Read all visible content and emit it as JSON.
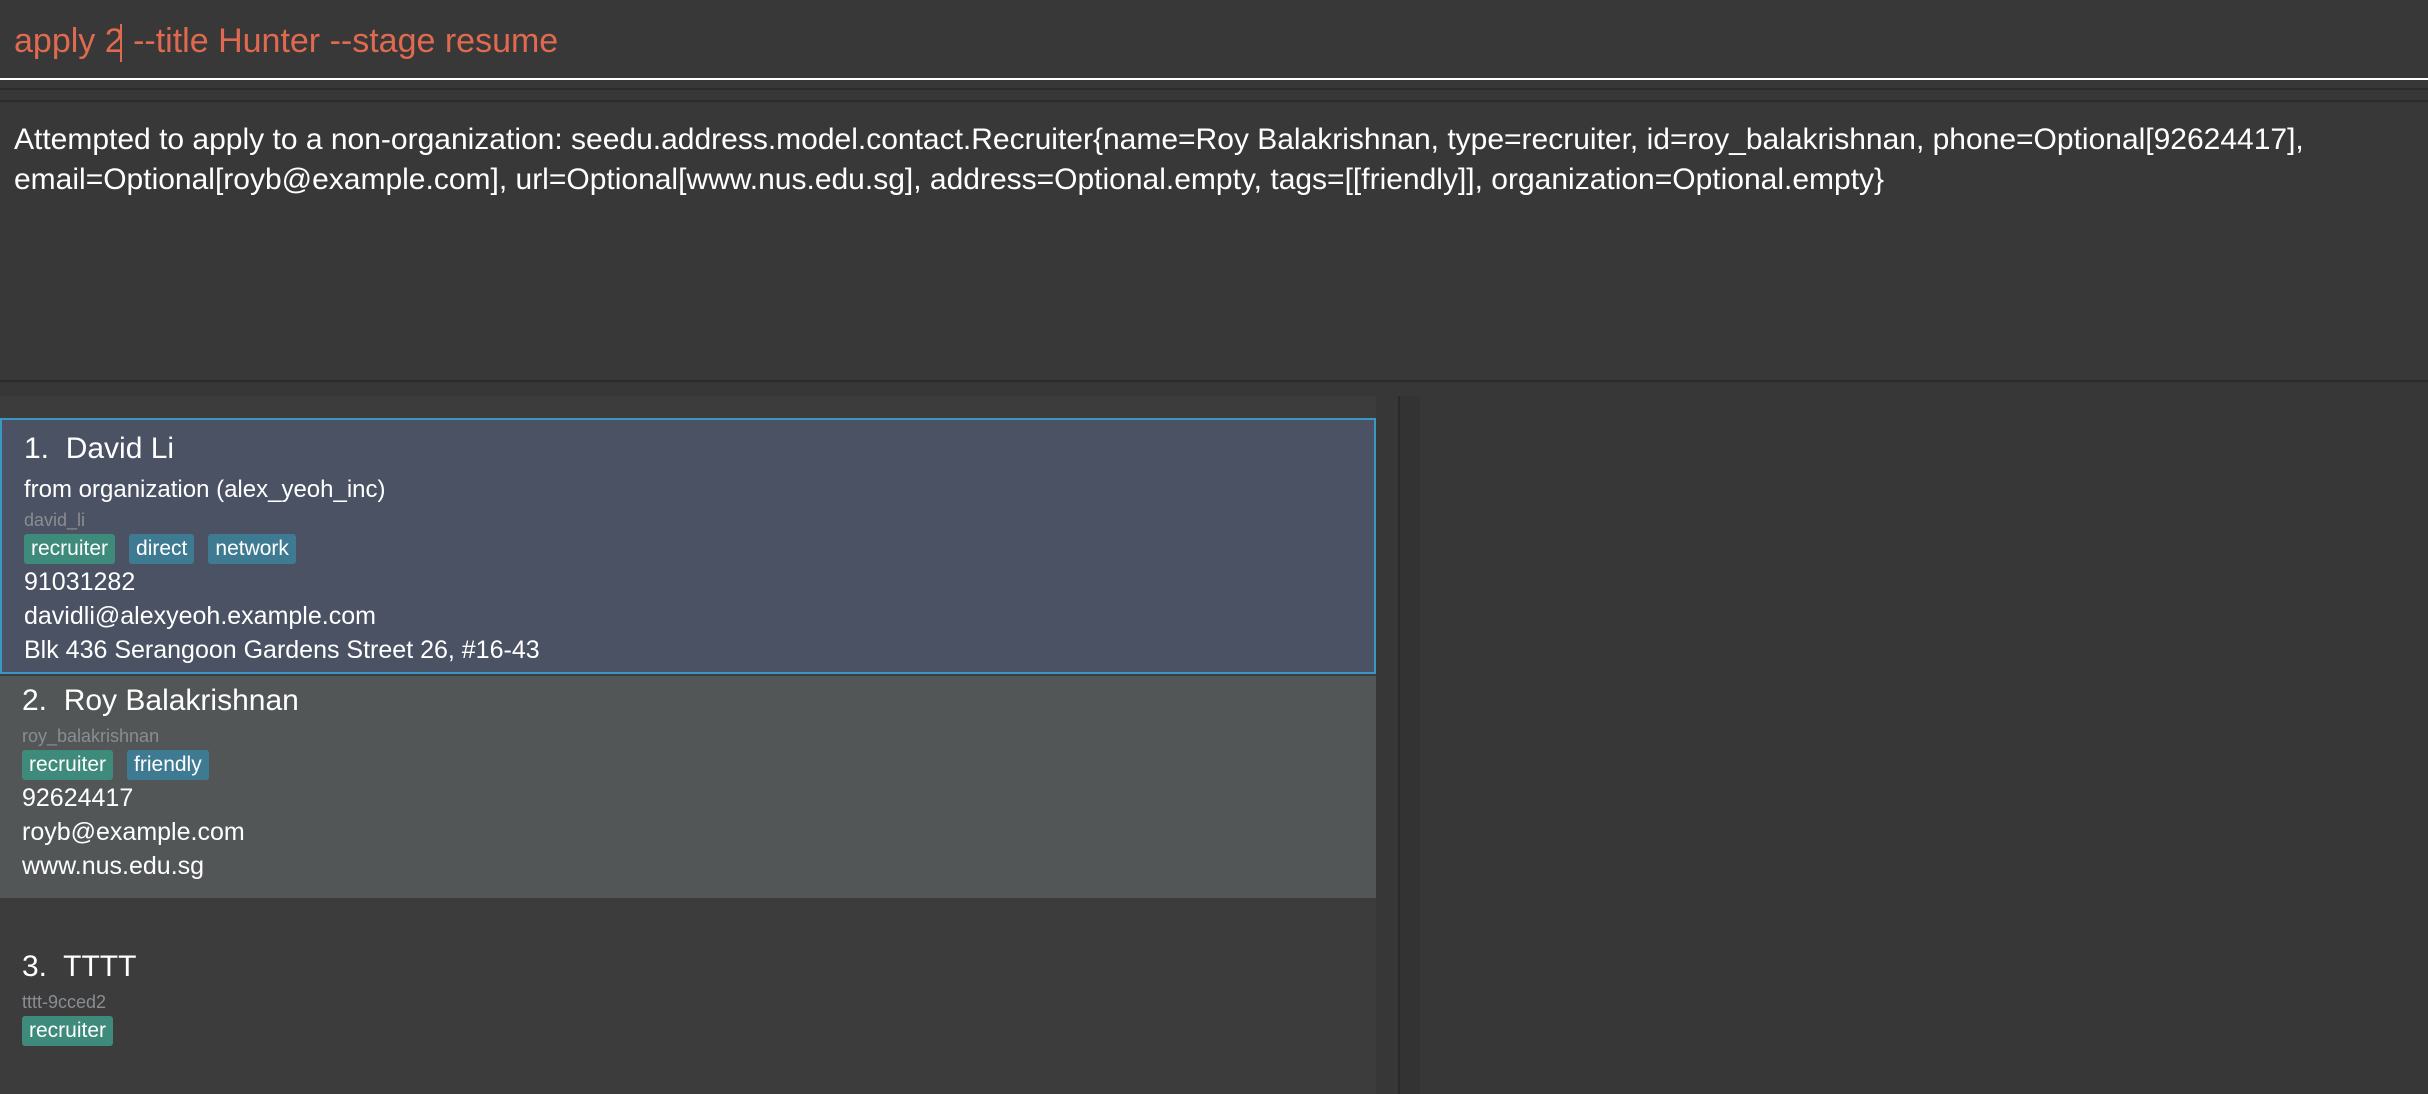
{
  "command_box": {
    "value": "apply 2 --title Hunter --stage resume"
  },
  "result_display": {
    "text": "Attempted to apply to a non-organization: seedu.address.model.contact.Recruiter{name=Roy Balakrishnan, type=recruiter, id=roy_balakrishnan, phone=Optional[92624417], email=Optional[royb@example.com], url=Optional[www.nus.edu.sg], address=Optional.empty, tags=[[friendly]], organization=Optional.empty}"
  },
  "contacts": [
    {
      "index_name": "1.  David Li",
      "from": "from organization (alex_yeoh_inc)",
      "id": "david_li",
      "tags": [
        "recruiter",
        "direct",
        "network"
      ],
      "phone": "91031282",
      "email": "davidli@alexyeoh.example.com",
      "address": "Blk 436 Serangoon Gardens Street 26, #16-43"
    },
    {
      "index_name": "2.  Roy Balakrishnan",
      "id": "roy_balakrishnan",
      "tags": [
        "recruiter",
        "friendly"
      ],
      "phone": "92624417",
      "email": "royb@example.com",
      "url": "www.nus.edu.sg"
    },
    {
      "index_name": "3.  TTTT",
      "id": "tttt-9cced2",
      "tags": [
        "recruiter"
      ]
    }
  ],
  "colors": {
    "command_text": "#e06a4f",
    "selected_card": "#4a5264",
    "tag_type": "#3e8a7b",
    "tag_other": "#3f7a93"
  }
}
